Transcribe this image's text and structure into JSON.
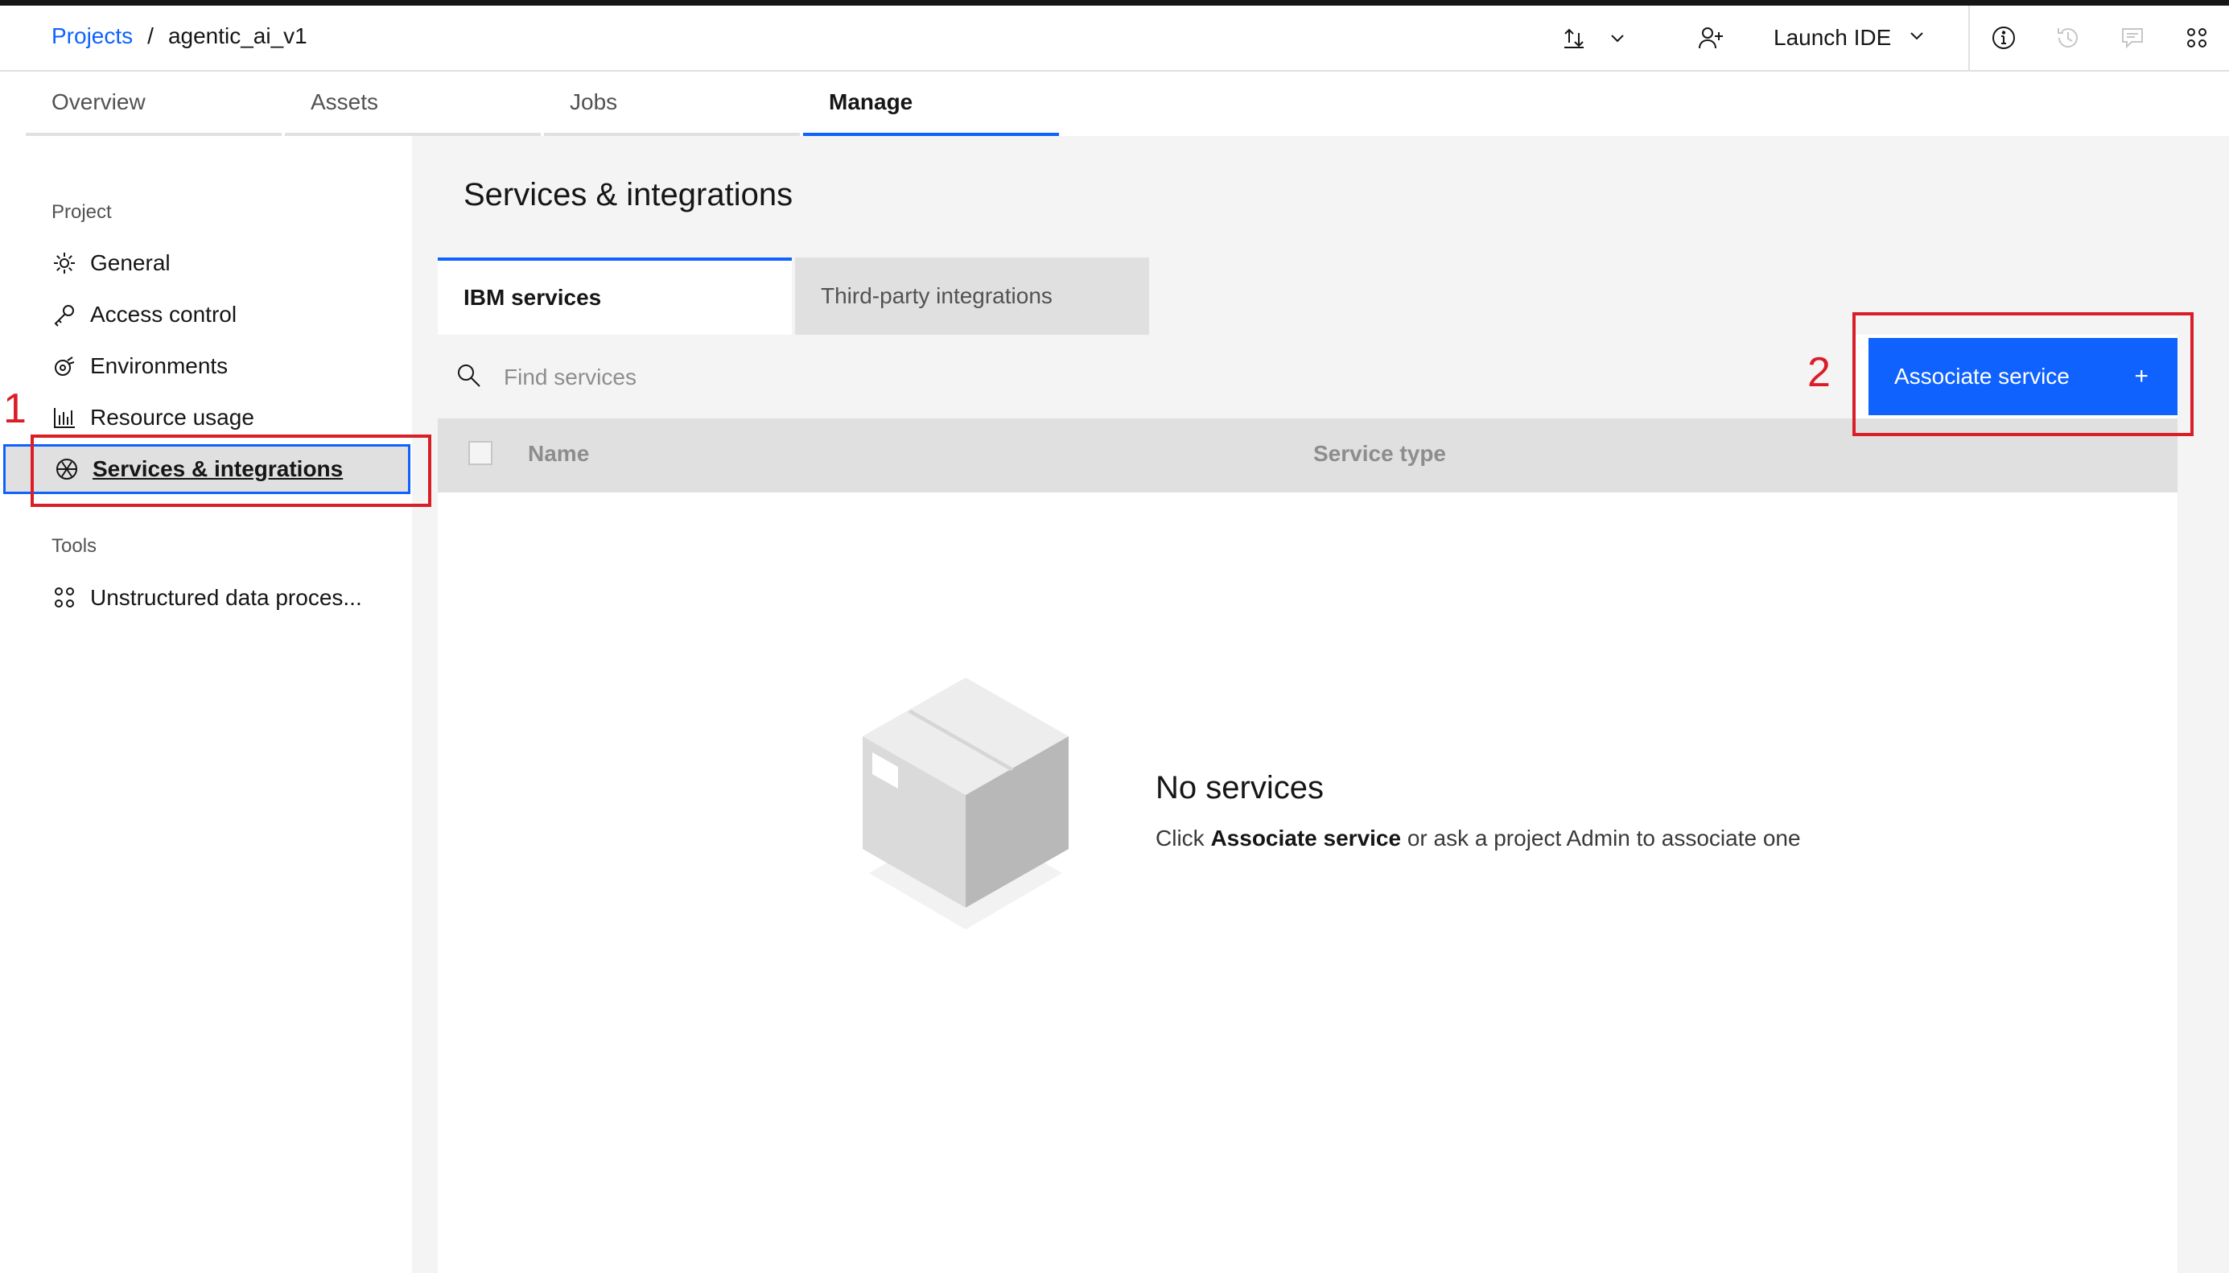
{
  "header": {
    "breadcrumb_link": "Projects",
    "breadcrumb_sep": "/",
    "breadcrumb_current": "agentic_ai_v1",
    "launch_label": "Launch IDE"
  },
  "tabs": [
    {
      "label": "Overview",
      "active": false
    },
    {
      "label": "Assets",
      "active": false
    },
    {
      "label": "Jobs",
      "active": false
    },
    {
      "label": "Manage",
      "active": true
    }
  ],
  "sidebar": {
    "section_project": "Project",
    "section_tools": "Tools",
    "items": [
      {
        "label": "General",
        "icon": "gear-icon"
      },
      {
        "label": "Access control",
        "icon": "key-icon"
      },
      {
        "label": "Environments",
        "icon": "environment-icon"
      },
      {
        "label": "Resource usage",
        "icon": "bar-chart-icon"
      },
      {
        "label": "Services & integrations",
        "icon": "services-icon",
        "active": true
      }
    ],
    "tools": [
      {
        "label": "Unstructured data proces...",
        "icon": "data-processing-icon"
      }
    ]
  },
  "main": {
    "title": "Services & integrations",
    "subtabs": [
      {
        "label": "IBM services",
        "active": true
      },
      {
        "label": "Third-party integrations",
        "active": false
      }
    ],
    "search_placeholder": "Find services",
    "associate_button": "Associate service",
    "associate_plus": "+",
    "columns": [
      "Name",
      "Service type"
    ],
    "empty_title": "No services",
    "empty_pre": "Click",
    "empty_bold": "Associate service",
    "empty_post": "or ask a project Admin to associate one"
  },
  "annotations": [
    "1",
    "2"
  ],
  "colors": {
    "accent": "#0f62fe",
    "annotation": "#da1e28"
  }
}
